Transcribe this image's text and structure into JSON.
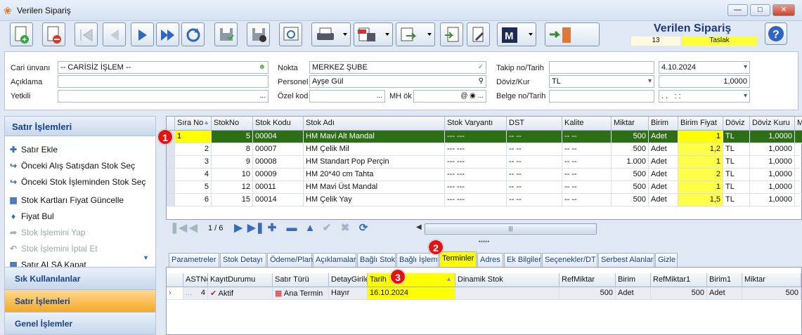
{
  "window": {
    "title": "Verilen Sipariş"
  },
  "doc": {
    "title": "Verilen Sipariş",
    "number": "13",
    "status": "Taslak"
  },
  "header": {
    "cari_label": "Cari ünvanı",
    "cari_value": "-- CARİSİZ İŞLEM --",
    "aciklama_label": "Açıklama",
    "aciklama_value": "",
    "yetkili_label": "Yetkili",
    "yetkili_value": "",
    "nokta_label": "Nokta",
    "nokta_value": "MERKEZ ŞUBE",
    "personel_label": "Personel",
    "personel_value": "Ayşe Gül",
    "ozelkod_label": "Özel kod",
    "ozelkod_value": "",
    "mhok_label": "MH ök",
    "mhok_value": "",
    "takip_label": "Takip no/Tarih",
    "takip_value": "",
    "takip_date": "4.10.2024",
    "doviz_label": "Döviz/Kur",
    "doviz_value": "TL",
    "kur_value": "1,0000",
    "belge_label": "Belge no/Tarih",
    "belge_value": "",
    "belge_date": ". .   : :"
  },
  "left": {
    "title": "Satır İşlemleri",
    "items": [
      "Satır Ekle",
      "Önceki Alış Satışdan Stok Seç",
      "Önceki Stok İşleminden Stok Seç",
      "Stok Kartları Fiyat Güncelle",
      "Fiyat Bul",
      "Stok İşlemini Yap",
      "Stok İşlemini İptal Et",
      "Satır ALSA Kapat"
    ],
    "sections": [
      "Sık Kullanılanlar",
      "Satır İşlemleri",
      "Genel İşlemler"
    ]
  },
  "grid": {
    "columns": [
      "Sıra No",
      "StokNo",
      "Stok Kodu",
      "Stok Adı",
      "Stok Varyantı",
      "DST",
      "Kalite",
      "Miktar",
      "Birim",
      "Birim Fiyat",
      "Döviz",
      "Döviz Kuru",
      "M"
    ],
    "rows": [
      [
        "1",
        "5",
        "00004",
        "HM Mavi Alt Mandal",
        "--- ---",
        "-- --",
        "-- --",
        "500",
        "Adet",
        "1",
        "TL",
        "1,0000"
      ],
      [
        "2",
        "8",
        "00007",
        "HM Çelik Mil",
        "--- ---",
        "-- --",
        "-- --",
        "500",
        "Adet",
        "1,2",
        "TL",
        "1,0000"
      ],
      [
        "3",
        "9",
        "00008",
        "HM Standart Pop Perçin",
        "--- ---",
        "-- --",
        "-- --",
        "1.000",
        "Adet",
        "1",
        "TL",
        "1,0000"
      ],
      [
        "4",
        "10",
        "00009",
        "HM 20*40 cm Tahta",
        "--- ---",
        "-- --",
        "-- --",
        "500",
        "Adet",
        "2",
        "TL",
        "1,0000"
      ],
      [
        "5",
        "12",
        "00011",
        "HM Mavi Üst Mandal",
        "--- ---",
        "-- --",
        "-- --",
        "500",
        "Adet",
        "1",
        "TL",
        "1,0000"
      ],
      [
        "6",
        "15",
        "00014",
        "HM Çelik Yay",
        "--- ---",
        "-- --",
        "-- --",
        "500",
        "Adet",
        "1,5",
        "TL",
        "1,0000"
      ]
    ],
    "pager": "1 / 6"
  },
  "tabs": [
    "Parametreler",
    "Stok Detayı",
    "Ödeme/Plan",
    "Açıklamalar",
    "Bağlı Stok",
    "Bağlı İşlem",
    "Terminler",
    "Adres",
    "Ek Bilgiler",
    "Seçenekler/DT",
    "Serbest Alanlar",
    "Gizle"
  ],
  "subgrid": {
    "columns": [
      "ASTNo",
      "KayıtDurumu",
      "Satır Türü",
      "DetayGirile",
      "Tarih",
      "Dinamik Stok",
      "RefMiktar",
      "Birim",
      "RefMiktar1",
      "Birim1",
      "Miktar"
    ],
    "row": [
      "4",
      "Aktif",
      "Ana Termin",
      "Hayır",
      "16.10.2024",
      "",
      "500",
      "Adet",
      "500",
      "Adet",
      "500"
    ]
  },
  "badges": [
    "1",
    "2",
    "3"
  ],
  "colors": {
    "selected_row": "#2e6e16",
    "highlight": "#ffff4a",
    "badge": "#e21313",
    "title": "#1b3a86"
  }
}
